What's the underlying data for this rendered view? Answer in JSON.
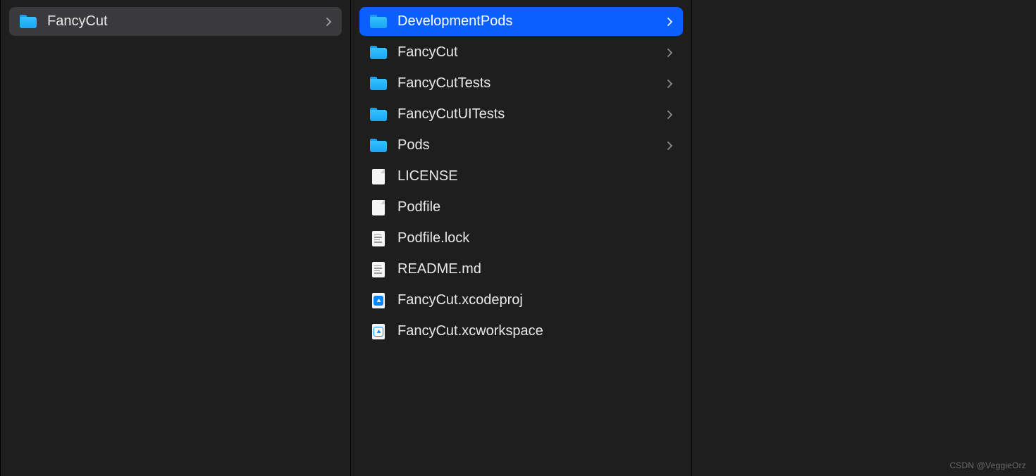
{
  "columns": [
    {
      "items": [
        {
          "name": "FancyCut",
          "type": "folder",
          "hasChildren": true,
          "state": "dim"
        }
      ]
    },
    {
      "items": [
        {
          "name": "DevelopmentPods",
          "type": "folder",
          "hasChildren": true,
          "state": "selected"
        },
        {
          "name": "FancyCut",
          "type": "folder",
          "hasChildren": true,
          "state": "none"
        },
        {
          "name": "FancyCutTests",
          "type": "folder",
          "hasChildren": true,
          "state": "none"
        },
        {
          "name": "FancyCutUITests",
          "type": "folder",
          "hasChildren": true,
          "state": "none"
        },
        {
          "name": "Pods",
          "type": "folder",
          "hasChildren": true,
          "state": "none"
        },
        {
          "name": "LICENSE",
          "type": "doc",
          "hasChildren": false,
          "state": "none"
        },
        {
          "name": "Podfile",
          "type": "doc",
          "hasChildren": false,
          "state": "none"
        },
        {
          "name": "Podfile.lock",
          "type": "textdoc",
          "hasChildren": false,
          "state": "none"
        },
        {
          "name": "README.md",
          "type": "textdoc",
          "hasChildren": false,
          "state": "none"
        },
        {
          "name": "FancyCut.xcodeproj",
          "type": "xcodeproj",
          "hasChildren": false,
          "state": "none"
        },
        {
          "name": "FancyCut.xcworkspace",
          "type": "xcworkspace",
          "hasChildren": false,
          "state": "none"
        }
      ]
    },
    {
      "items": []
    }
  ],
  "watermark": "CSDN @VeggieOrz"
}
